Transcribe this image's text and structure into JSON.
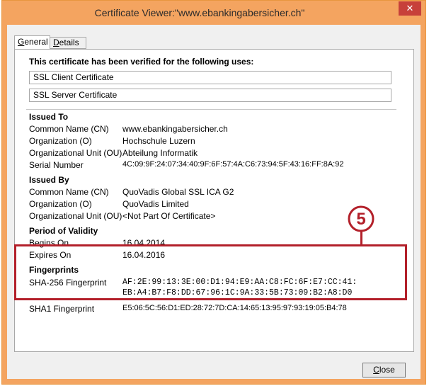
{
  "window": {
    "title": "Certificate Viewer:\"www.ebankingabersicher.ch\"",
    "close_glyph": "✕"
  },
  "tabs": [
    {
      "label": "General",
      "selected": true
    },
    {
      "label": "Details",
      "selected": false
    }
  ],
  "verified": {
    "heading": "This certificate has been verified for the following uses:",
    "uses": [
      "SSL Client Certificate",
      "SSL Server Certificate"
    ]
  },
  "issued_to": {
    "heading": "Issued To",
    "rows": [
      {
        "label": "Common Name (CN)",
        "value": "www.ebankingabersicher.ch"
      },
      {
        "label": "Organization (O)",
        "value": "Hochschule Luzern"
      },
      {
        "label": "Organizational Unit (OU)",
        "value": "Abteilung Informatik"
      },
      {
        "label": "Serial Number",
        "value": "4C:09:9F:24:07:34:40:9F:6F:57:4A:C6:73:94:5F:43:16:FF:8A:92"
      }
    ]
  },
  "issued_by": {
    "heading": "Issued By",
    "rows": [
      {
        "label": "Common Name (CN)",
        "value": "QuoVadis Global SSL ICA G2"
      },
      {
        "label": "Organization (O)",
        "value": "QuoVadis Limited"
      },
      {
        "label": "Organizational Unit (OU)",
        "value": "<Not Part Of Certificate>"
      }
    ]
  },
  "validity": {
    "heading": "Period of Validity",
    "rows": [
      {
        "label": "Begins On",
        "value": "16.04.2014"
      },
      {
        "label": "Expires On",
        "value": "16.04.2016"
      }
    ]
  },
  "fingerprints": {
    "heading": "Fingerprints",
    "sha256_label": "SHA-256 Fingerprint",
    "sha256_line1": "AF:2E:99:13:3E:00:D1:94:E9:AA:C8:FC:6F:E7:CC:41:",
    "sha256_line2": "EB:A4:B7:F8:DD:67:96:1C:9A:33:5B:73:09:B2:A8:D0",
    "sha1_label": "SHA1 Fingerprint",
    "sha1_value": "E5:06:5C:56:D1:ED:28:72:7D:CA:14:65:13:95:97:93:19:05:B4:78"
  },
  "callout": {
    "number": "5",
    "color": "#b3202a"
  },
  "buttons": {
    "close_label": "Close"
  }
}
